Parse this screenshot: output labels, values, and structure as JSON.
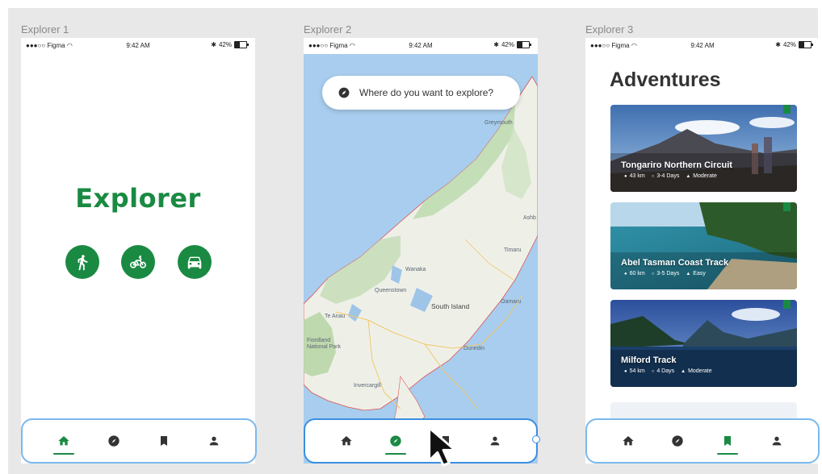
{
  "frames": [
    {
      "label": "Explorer 1"
    },
    {
      "label": "Explorer 2"
    },
    {
      "label": "Explorer 3"
    }
  ],
  "status_bar": {
    "carrier": "●●●○○ Figma",
    "wifi_icon": "wifi-icon",
    "time": "9:42 AM",
    "bluetooth": "✱",
    "battery": "42%"
  },
  "explorer1": {
    "logo": "Explorer",
    "modes": [
      "walk-icon",
      "bike-icon",
      "car-icon"
    ]
  },
  "explorer2": {
    "search_placeholder": "Where do you want to explore?",
    "map_labels": {
      "greymouth": "Greymouth",
      "wanaka": "Wanaka",
      "queenstown": "Queenstown",
      "south_island": "South Island",
      "timaru": "Timaru",
      "oamaru": "Oamaru",
      "te_anau": "Te Anau",
      "fiordland": "Fiordland National Park",
      "dunedin": "Dunedin",
      "invercargill": "Invercargill",
      "ashburton": "Ashb"
    }
  },
  "explorer3": {
    "title": "Adventures",
    "cards": [
      {
        "name": "Tongariro Northern Circuit",
        "distance": "43 km",
        "duration": "3-4 Days",
        "difficulty": "Moderate"
      },
      {
        "name": "Abel Tasman Coast Track",
        "distance": "60 km",
        "duration": "3-5 Days",
        "difficulty": "Easy"
      },
      {
        "name": "Milford Track",
        "distance": "54 km",
        "duration": "4 Days",
        "difficulty": "Moderate"
      }
    ]
  },
  "tabbar": {
    "items": [
      "home-icon",
      "compass-icon",
      "bookmark-icon",
      "profile-icon"
    ],
    "active": [
      "home",
      "compass",
      "bookmark"
    ]
  },
  "colors": {
    "brand_green": "#1a8a43",
    "tabbar_outline": "#7ab8ec",
    "map_water": "#a8cdee"
  }
}
